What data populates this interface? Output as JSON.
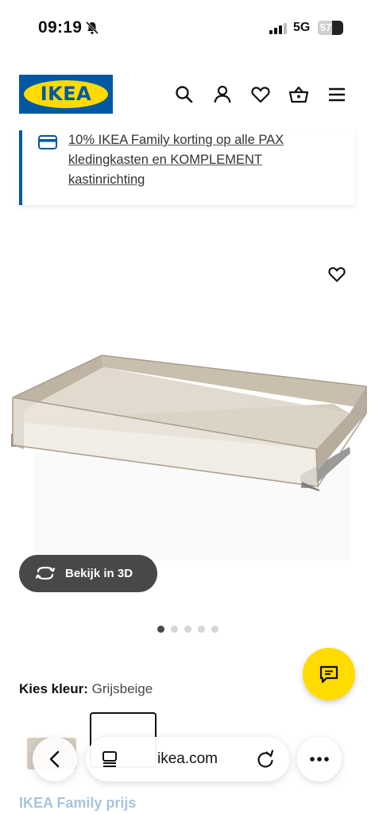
{
  "status_bar": {
    "time": "09:19",
    "network": "5G",
    "battery": "57",
    "battery_level": 0.57,
    "icons": [
      "bell-off-icon",
      "signal-icon",
      "battery-icon"
    ]
  },
  "header": {
    "logo_text": "IKEA",
    "icons": [
      "search-icon",
      "user-icon",
      "heart-icon",
      "basket-icon",
      "menu-icon"
    ],
    "brand_blue": "#0058a3",
    "brand_yellow": "#ffdb00"
  },
  "banner": {
    "text": "10% IKEA Family korting op alle PAX kledingkasten en KOMPLEMENT kastinrichting",
    "icon": "credit-card-icon"
  },
  "gallery": {
    "view_3d_label": "Bekijk in 3D",
    "dot_count": 5,
    "active_dot": 0
  },
  "product": {
    "color_label": "Kies kleur:",
    "color_value": "Grijsbeige",
    "family_price_label": "IKEA Family prijs"
  },
  "browser": {
    "url": "ikea.com"
  }
}
